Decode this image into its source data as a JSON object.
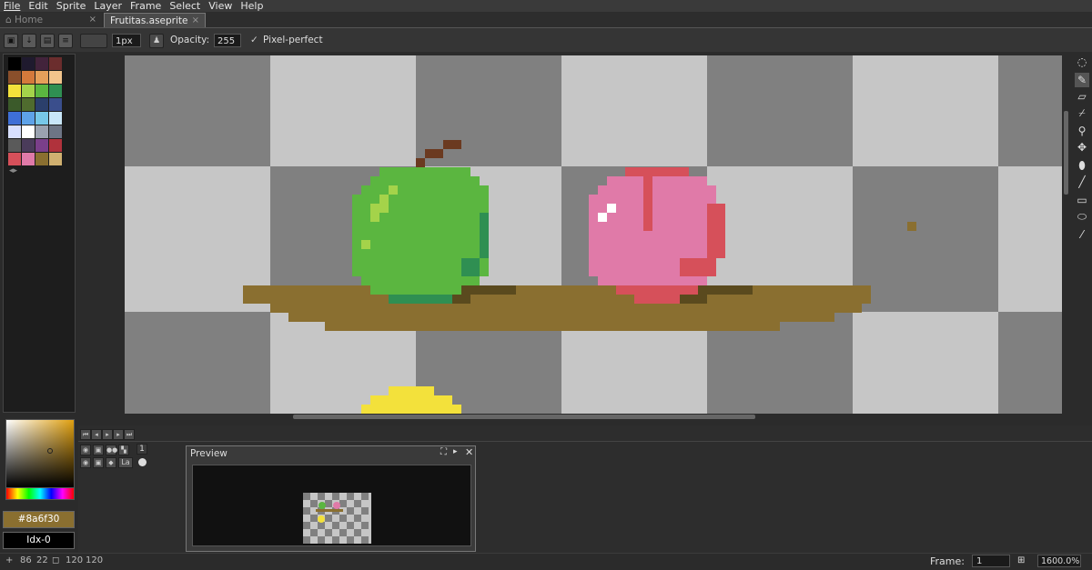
{
  "menu": [
    "File",
    "Edit",
    "Sprite",
    "Layer",
    "Frame",
    "Select",
    "View",
    "Help"
  ],
  "tabs": {
    "home": "Home",
    "document": "Frutitas.aseprite",
    "close": "×"
  },
  "context_bar": {
    "brush_size": "1px",
    "opacity_label": "Opacity:",
    "opacity_value": "255",
    "pixel_perfect_label": "Pixel-perfect",
    "pixel_perfect_checked": true
  },
  "palette": [
    "#000000",
    "#1f1a2e",
    "#42233b",
    "#6b2d2d",
    "#8a4f2b",
    "#d4793b",
    "#e6a05a",
    "#f2c48c",
    "#f3e13b",
    "#a4d34a",
    "#5bb640",
    "#2f8f52",
    "#3b5a2a",
    "#4f6b2e",
    "#2b3f6b",
    "#3a4e8c",
    "#3e6fd6",
    "#5ea2e8",
    "#77c8e8",
    "#c8e6f8",
    "#d8e0ff",
    "#ffffff",
    "#9aa2b0",
    "#6d7585",
    "#5a5a5a",
    "#4a3b5a",
    "#7a3f8a",
    "#b0323c",
    "#d6505a",
    "#e07aa8",
    "#8a6f30",
    "#d0b070"
  ],
  "colors": {
    "foreground": "#8a6f30",
    "foreground_label": "#8a6f30",
    "background_label": "Idx-0"
  },
  "tools": [
    "marquee-icon",
    "pencil-icon",
    "eraser-icon",
    "eyedropper-icon",
    "zoom-icon",
    "move-icon",
    "bucket-icon",
    "line-icon",
    "rectangle-icon",
    "ellipse-icon",
    "spray-icon"
  ],
  "timeline": {
    "frame_number": "1",
    "layer_name": "La"
  },
  "preview": {
    "title": "Preview"
  },
  "status": {
    "cursor_x": "86",
    "cursor_y": "22",
    "size_w": "120",
    "size_h": "120",
    "frame_label": "Frame:",
    "frame_value": "1",
    "zoom": "1600.0%"
  }
}
